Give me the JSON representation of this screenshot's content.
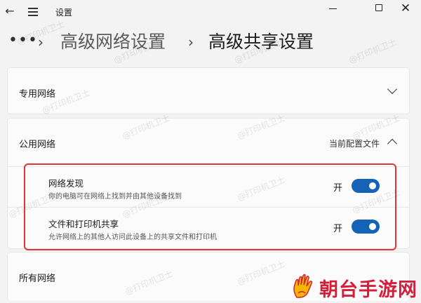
{
  "window": {
    "title": "设置"
  },
  "breadcrumb": {
    "overflow": "•••",
    "separator": "›",
    "items": [
      "高级网络设置",
      "高级共享设置"
    ]
  },
  "sections": {
    "private": {
      "label": "专用网络"
    },
    "public": {
      "label": "公用网络",
      "current_profile": "当前配置文件",
      "rows": [
        {
          "title": "网络发现",
          "desc": "你的电脑可在网络上找到并由其他设备找到",
          "state": "开",
          "on": true
        },
        {
          "title": "文件和打印机共享",
          "desc": "允许网络上的其他人访问此设备上的共享文件和打印机",
          "state": "开",
          "on": true
        }
      ]
    },
    "all": {
      "label": "所有网络"
    }
  },
  "watermark": "@打印机卫士",
  "brand": {
    "text": "朝台手游网"
  },
  "colors": {
    "toggle_on": "#1463b6",
    "highlight": "#e0363b",
    "brand": "#d41f3a"
  }
}
